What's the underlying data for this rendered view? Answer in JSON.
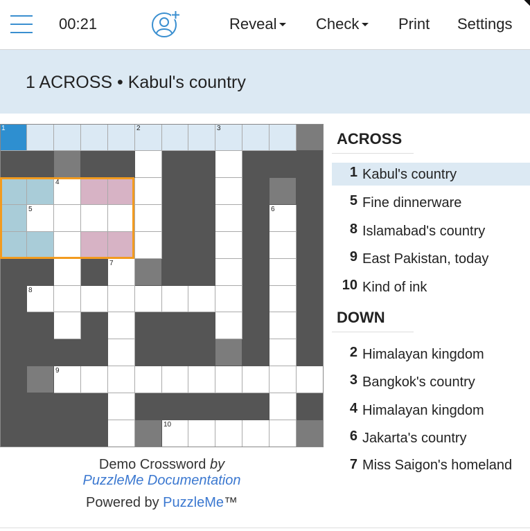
{
  "toolbar": {
    "timer": "00:21",
    "reveal_label": "Reveal",
    "check_label": "Check",
    "print_label": "Print",
    "settings_label": "Settings",
    "accent_color": "#3a8fd0"
  },
  "current_clue": "1 ACROSS • Kabul's country",
  "grid": {
    "rows": [
      "CAAAAAAAAAAG",
      "BBGBBWBBWBBB",
      "TTWPPWBBWBGB",
      "TWWWWWBBWBWB",
      "TTWPPWBBWBWB",
      "BBWBWGBBWBWB",
      "BWWWWWWWWBWB",
      "BBWBWBBBWBWB",
      "BBBBWBBBGBWB",
      "BGWWWWWWWWWW",
      "BBBBWBBBBBWB",
      "BBBBWGWWWWWG"
    ],
    "numbers": [
      {
        "r": 0,
        "c": 0,
        "n": "1"
      },
      {
        "r": 0,
        "c": 5,
        "n": "2"
      },
      {
        "r": 0,
        "c": 8,
        "n": "3"
      },
      {
        "r": 2,
        "c": 2,
        "n": "4"
      },
      {
        "r": 3,
        "c": 1,
        "n": "5"
      },
      {
        "r": 3,
        "c": 10,
        "n": "6"
      },
      {
        "r": 5,
        "c": 4,
        "n": "7"
      },
      {
        "r": 6,
        "c": 1,
        "n": "8"
      },
      {
        "r": 9,
        "c": 2,
        "n": "9"
      },
      {
        "r": 11,
        "c": 6,
        "n": "10"
      }
    ]
  },
  "credits": {
    "title": "Demo Crossword",
    "by": "by",
    "author": "PuzzleMe Documentation",
    "powered_prefix": "Powered by ",
    "powered_brand": "PuzzleMe",
    "powered_suffix": "™"
  },
  "clues": {
    "across_heading": "ACROSS",
    "down_heading": "DOWN",
    "across": [
      {
        "num": "1",
        "text": "Kabul's country"
      },
      {
        "num": "5",
        "text": "Fine dinnerware"
      },
      {
        "num": "8",
        "text": "Islamabad's country"
      },
      {
        "num": "9",
        "text": "East Pakistan, today"
      },
      {
        "num": "10",
        "text": "Kind of ink"
      }
    ],
    "down": [
      {
        "num": "2",
        "text": "Himalayan kingdom"
      },
      {
        "num": "3",
        "text": "Bangkok's country"
      },
      {
        "num": "4",
        "text": "Himalayan kingdom"
      },
      {
        "num": "6",
        "text": "Jakarta's country"
      },
      {
        "num": "7",
        "text": "Miss Saigon's homeland"
      }
    ]
  }
}
